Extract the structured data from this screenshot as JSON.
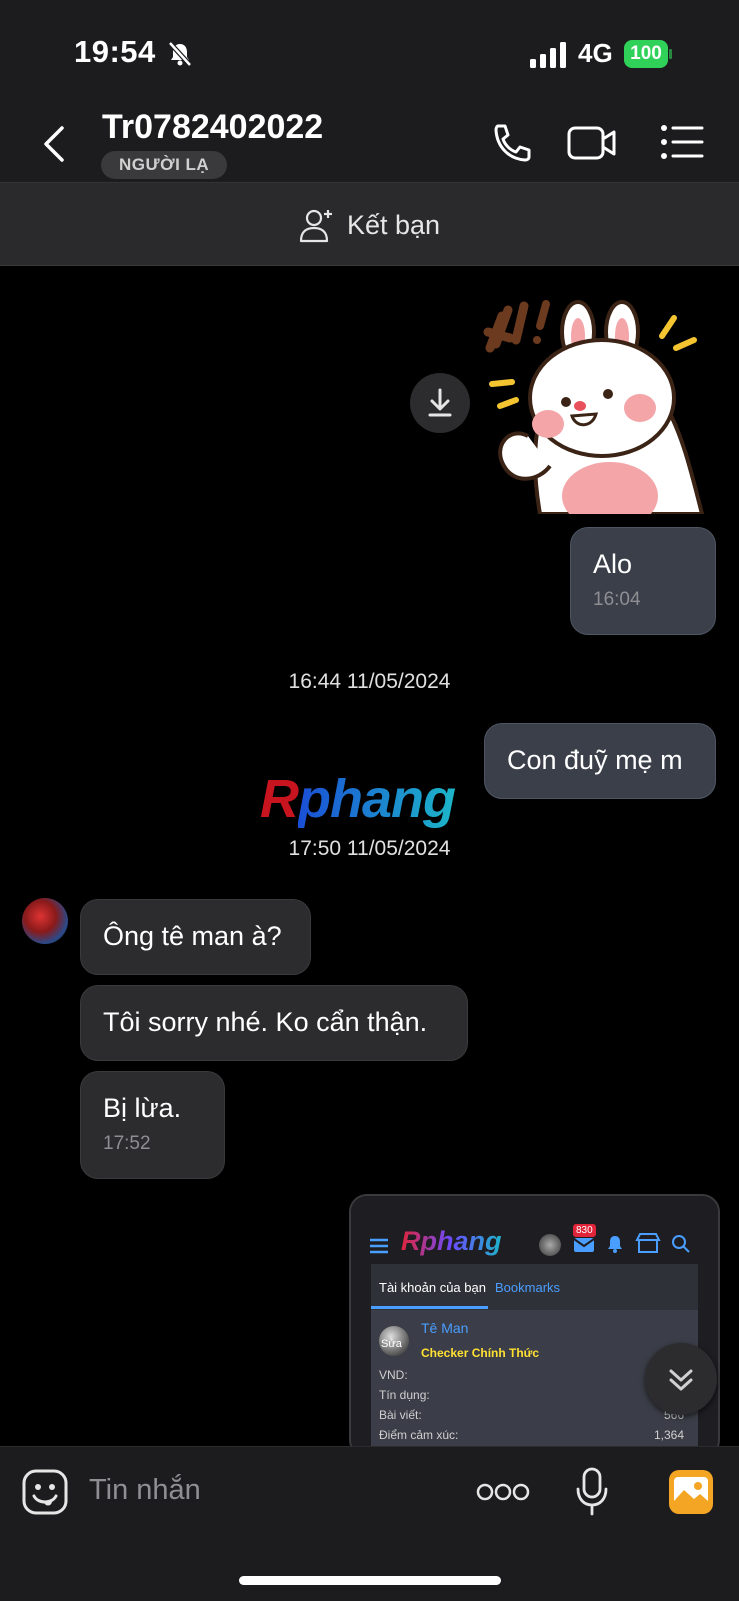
{
  "status_bar": {
    "time": "19:54",
    "network": "4G",
    "battery": "100"
  },
  "header": {
    "title": "Tr0782402022",
    "badge": "NGƯỜI LẠ"
  },
  "friend_bar": {
    "label": "Kết bạn"
  },
  "messages": {
    "m1": {
      "text": "Alo",
      "time": "16:04"
    },
    "stamp1": "16:44 11/05/2024",
    "m2": {
      "text": "Con đuỹ mẹ m"
    },
    "stamp2": "17:50 11/05/2024",
    "m3": {
      "text": "Ông tê man à?"
    },
    "m4": {
      "text": "Tôi sorry nhé. Ko cẩn thận."
    },
    "m5": {
      "text": "Bị lừa.",
      "time": "17:52"
    }
  },
  "watermark": {
    "r": "R",
    "rest": "phang"
  },
  "screenshot_preview": {
    "logo": "Rphang",
    "mail_count": "830",
    "tab_account": "Tài khoản của bạn",
    "tab_bookmarks": "Bookmarks",
    "avatar_label": "Sửa",
    "user_name": "Tê Man",
    "user_role": "Checker Chính Thức",
    "rows": [
      {
        "label": "VND:",
        "value": ""
      },
      {
        "label": "Tín dụng:",
        "value": ""
      },
      {
        "label": "Bài viết:",
        "value": "566"
      },
      {
        "label": "Điểm cảm xúc:",
        "value": "1,364"
      }
    ]
  },
  "input_bar": {
    "placeholder": "Tin nhắn"
  },
  "colors": {
    "outgoing_bubble": "#3a3f4a",
    "incoming_bubble": "#2c2c2e",
    "accent": "#4a9eff"
  }
}
